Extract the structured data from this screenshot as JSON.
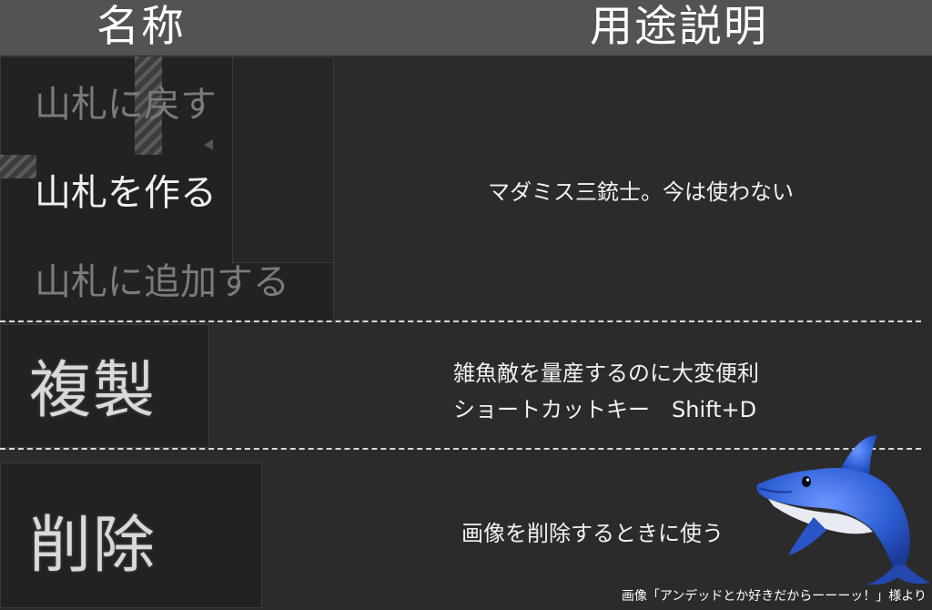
{
  "header": {
    "name_col": "名称",
    "desc_col": "用途説明"
  },
  "deck_menu": {
    "items": [
      {
        "label": "山札に戻す",
        "state": "disabled"
      },
      {
        "label": "山札を作る",
        "state": "enabled"
      },
      {
        "label": "山札に追加する",
        "state": "disabled"
      }
    ],
    "description": "マダミス三銃士。今は使わない"
  },
  "duplicate": {
    "label": "複製",
    "description_lines": [
      "雑魚敵を量産するのに大変便利",
      "ショートカットキー　Shift+D"
    ]
  },
  "delete": {
    "label": "削除",
    "description": "画像を削除するときに使う"
  },
  "credit": "画像「アンデッドとか好きだからーーーッ！」様より",
  "colors": {
    "header_bg": "#535353",
    "body_bg": "#2b2b2b",
    "dolphin": "#2f5fd6"
  }
}
